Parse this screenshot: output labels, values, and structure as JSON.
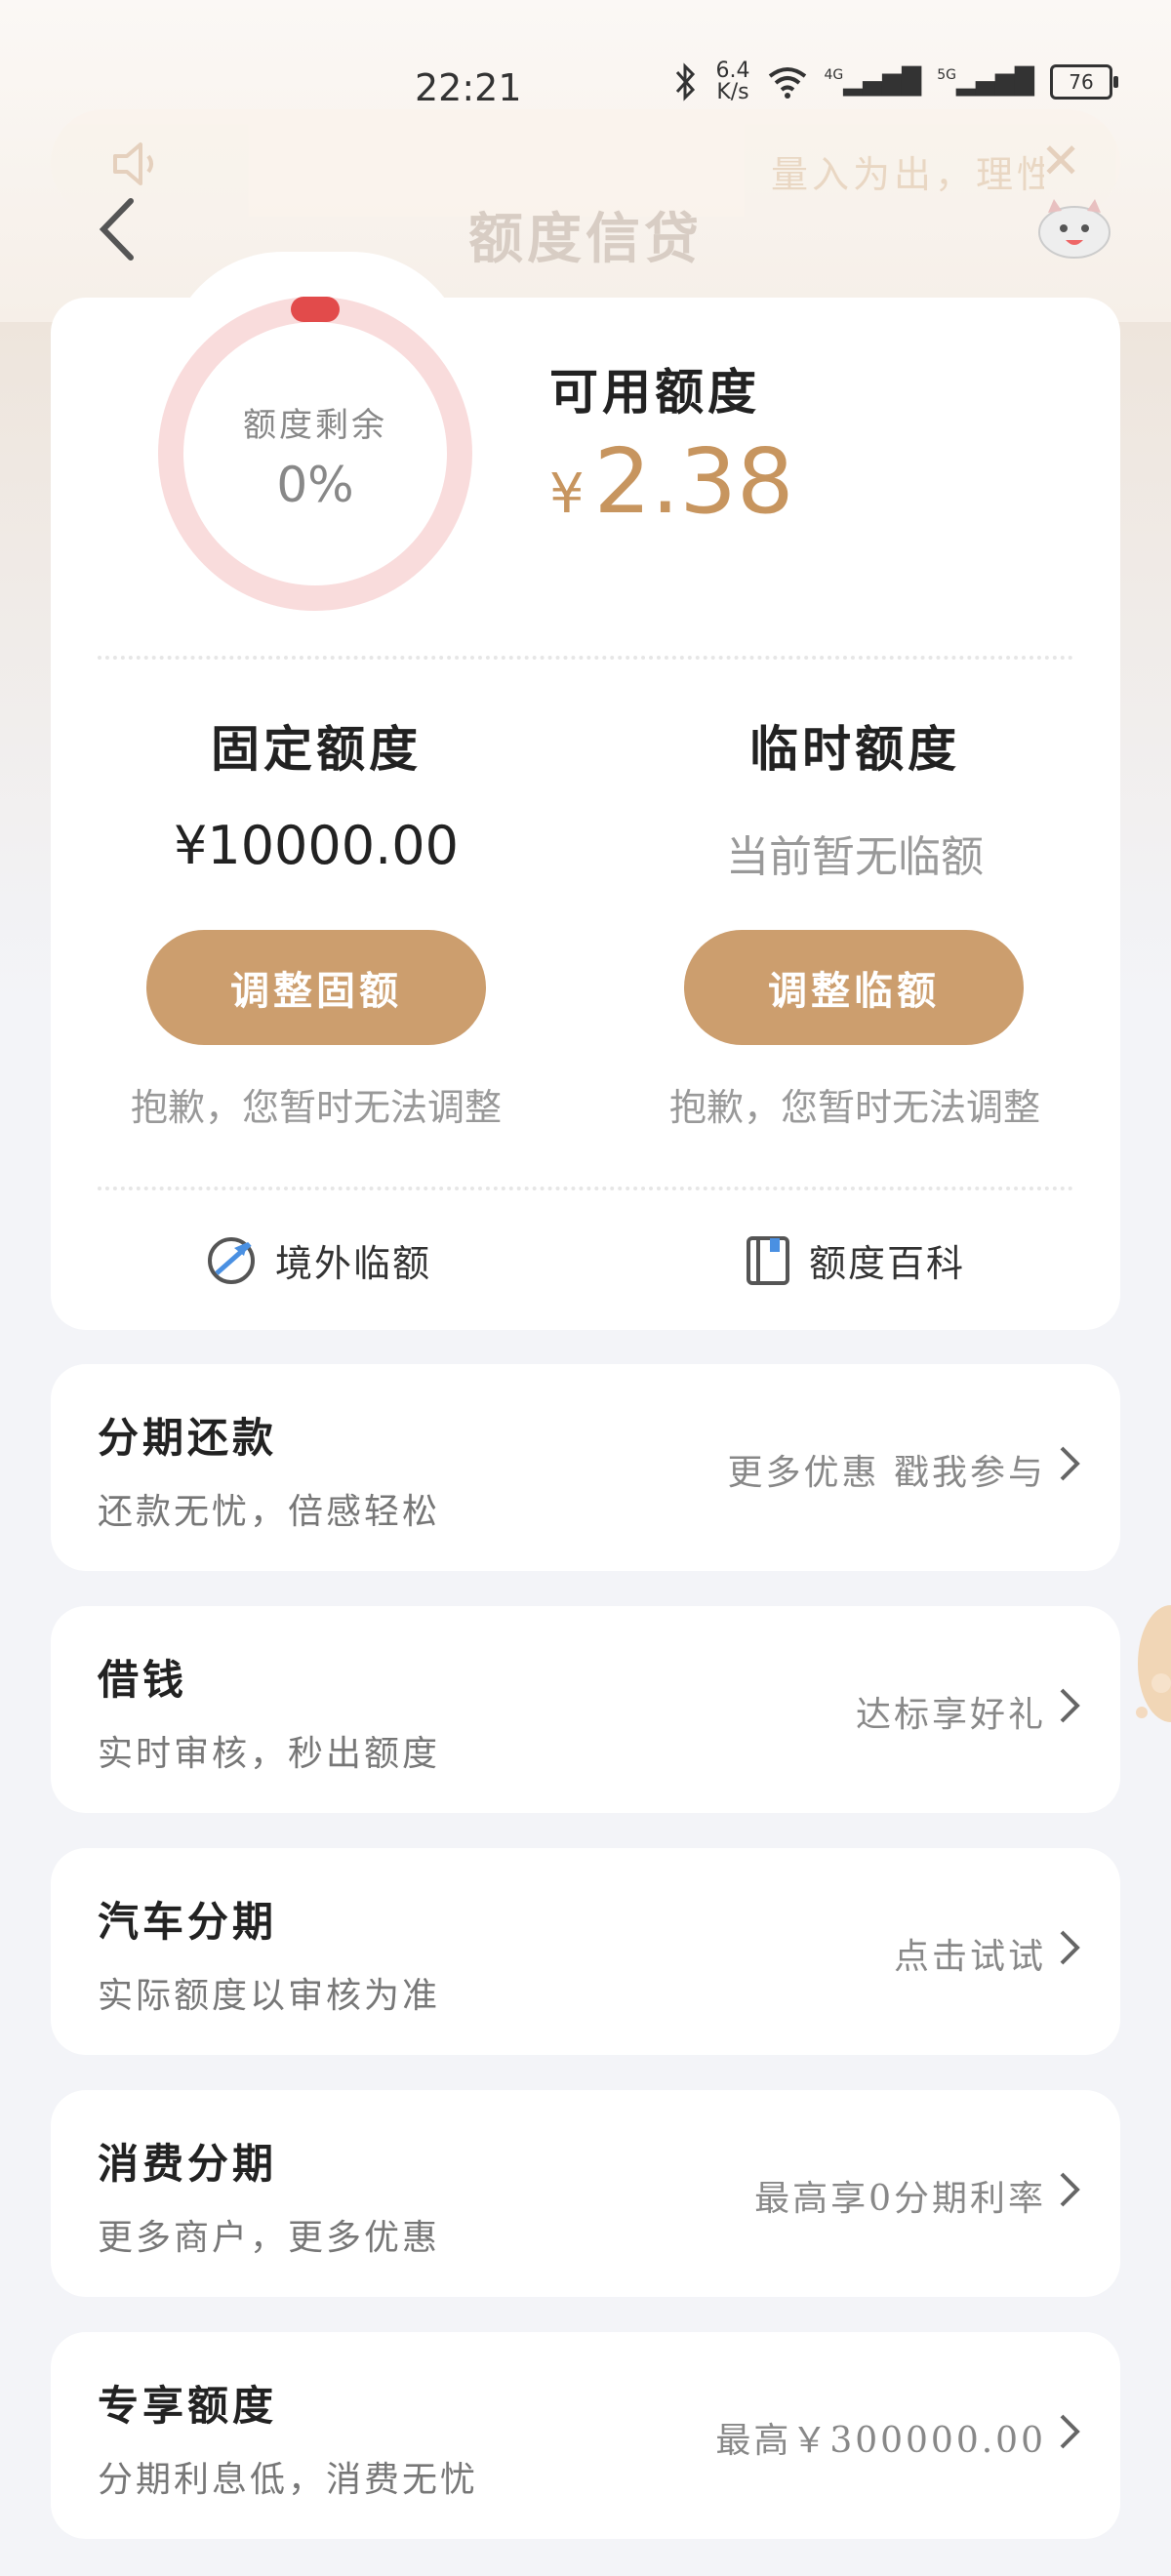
{
  "status": {
    "time": "22:21",
    "speed_top": "6.4",
    "speed_bottom": "K/s",
    "net1": "4G",
    "net2": "5G",
    "battery": "76"
  },
  "notice": {
    "text": "量入为出，理性",
    "close": "✕"
  },
  "nav": {
    "title": "额度信贷"
  },
  "summary": {
    "ring_label": "额度剩余",
    "ring_percent": "0%",
    "remaining_fraction": 0,
    "available_label": "可用额度",
    "currency": "¥",
    "available_amount": "2.38"
  },
  "fixed": {
    "title": "固定额度",
    "amount": "¥10000.00",
    "button": "调整固额",
    "note": "抱歉，您暂时无法调整"
  },
  "temporary": {
    "title": "临时额度",
    "status": "当前暂无临额",
    "button": "调整临额",
    "note": "抱歉，您暂时无法调整"
  },
  "links": {
    "overseas": "境外临额",
    "wiki": "额度百科"
  },
  "list": [
    {
      "title": "分期还款",
      "subtitle": "还款无忧，倍感轻松",
      "action": "更多优惠 戳我参与"
    },
    {
      "title": "借钱",
      "subtitle": "实时审核，秒出额度",
      "action": "达标享好礼"
    },
    {
      "title": "汽车分期",
      "subtitle": "实际额度以审核为准",
      "action": "点击试试"
    },
    {
      "title": "消费分期",
      "subtitle": "更多商户，更多优惠",
      "action": "最高享0分期利率"
    },
    {
      "title": "专享额度",
      "subtitle": "分期利息低，消费无忧",
      "action": "最高￥300000.00"
    }
  ],
  "colors": {
    "accent": "#cc9e6e",
    "amount": "#c7955f",
    "ring": "#f9dcdc",
    "ring_marker": "#e24b4b"
  },
  "icons": [
    "speaker-icon",
    "close-icon",
    "back-arrow-icon",
    "mascot-icon",
    "plane-globe-icon",
    "book-icon",
    "chevron-right-icon"
  ]
}
